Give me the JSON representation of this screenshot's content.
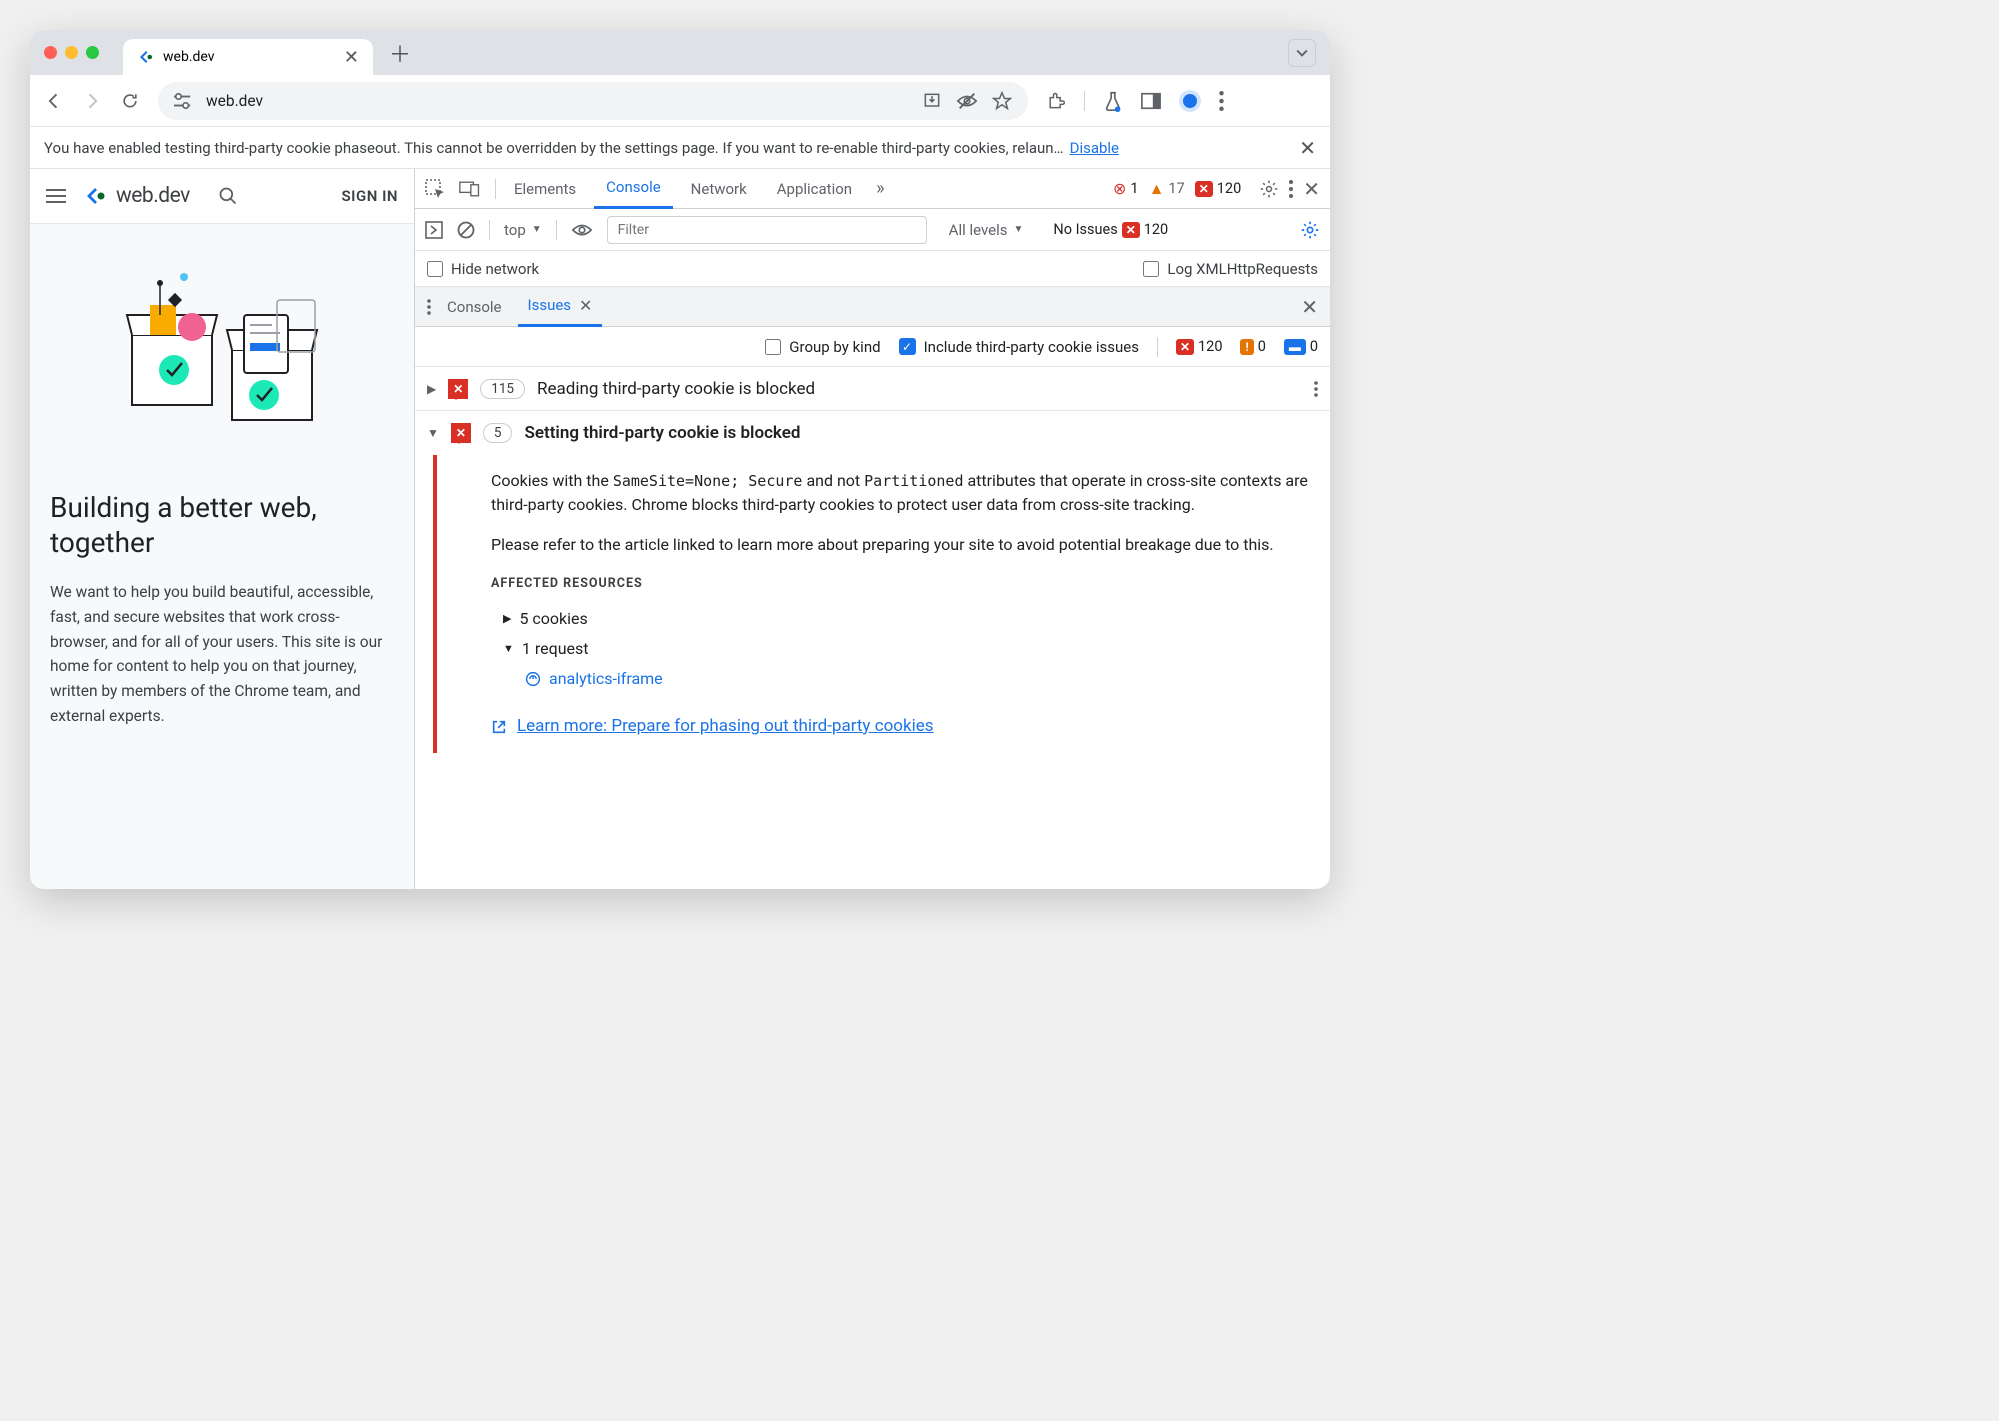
{
  "browser": {
    "tab_title": "web.dev",
    "url": "web.dev"
  },
  "infobar": {
    "text": "You have enabled testing third-party cookie phaseout. This cannot be overridden by the settings page. If you want to re-enable third-party cookies, relaun…",
    "link": "Disable"
  },
  "page": {
    "logo_text": "web.dev",
    "signin": "SIGN IN",
    "heading": "Building a better web, together",
    "description": "We want to help you build beautiful, accessible, fast, and secure websites that work cross-browser, and for all of your users. This site is our home for content to help you on that journey, written by members of the Chrome team, and external experts."
  },
  "devtools": {
    "tabs": {
      "elements": "Elements",
      "console": "Console",
      "network": "Network",
      "application": "Application"
    },
    "counts": {
      "errors": "1",
      "warnings": "17",
      "blocked": "120"
    },
    "console": {
      "context": "top",
      "filter_placeholder": "Filter",
      "levels": "All levels",
      "no_issues": "No Issues",
      "no_issues_count": "120",
      "hide_network": "Hide network",
      "log_xhr": "Log XMLHttpRequests"
    },
    "drawer": {
      "console": "Console",
      "issues": "Issues"
    },
    "issues_toolbar": {
      "group": "Group by kind",
      "include": "Include third-party cookie issues",
      "c1": "120",
      "c2": "0",
      "c3": "0"
    },
    "issue1": {
      "count": "115",
      "title": "Reading third-party cookie is blocked"
    },
    "issue2": {
      "count": "5",
      "title": "Setting third-party cookie is blocked",
      "p1a": "Cookies with the ",
      "code1": "SameSite=None; Secure",
      "p1b": " and not ",
      "code2": "Partitioned",
      "p1c": " attributes that operate in cross-site contexts are third-party cookies. Chrome blocks third-party cookies to protect user data from cross-site tracking.",
      "p2": "Please refer to the article linked to learn more about preparing your site to avoid potential breakage due to this.",
      "affected_hd": "AFFECTED RESOURCES",
      "res1": "5 cookies",
      "res2": "1 request",
      "res3": "analytics-iframe",
      "learn": "Learn more: Prepare for phasing out third-party cookies"
    }
  }
}
